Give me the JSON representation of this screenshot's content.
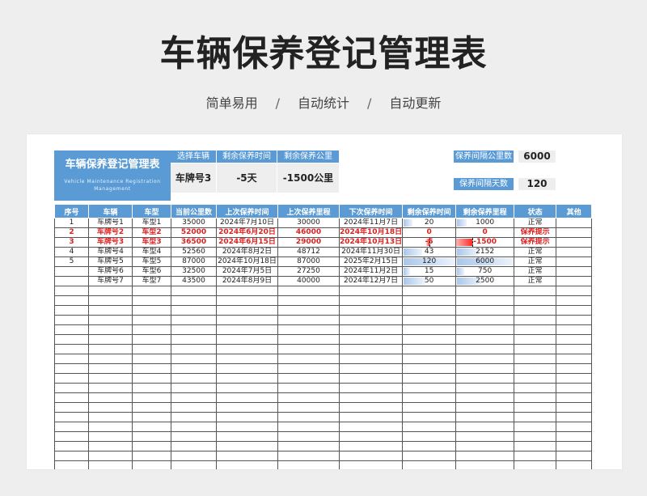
{
  "header": {
    "title": "车辆保养登记管理表",
    "tags": [
      "简单易用",
      "自动统计",
      "自动更新"
    ],
    "separator": "/"
  },
  "title_block": {
    "cn": "车辆保养登记管理表",
    "en": "Vehicle Maintenance Registration Management"
  },
  "selector": {
    "labels": [
      "选择车辆",
      "剩余保养时间",
      "剩余保养公里"
    ],
    "values": [
      "车牌号3",
      "-5天",
      "-1500公里"
    ]
  },
  "params": {
    "km_label": "保养间隔公里数",
    "km_value": "6000",
    "days_label": "保养间隔天数",
    "days_value": "120"
  },
  "table": {
    "columns": [
      "序号",
      "车辆",
      "车型",
      "当前公里数",
      "上次保养时间",
      "上次保养里程",
      "下次保养时间",
      "剩余保养时间",
      "剩余保养里程",
      "状态",
      "其他"
    ],
    "rows": [
      {
        "seq": "1",
        "car": "车牌号1",
        "model": "车型1",
        "km": "35000",
        "last_date": "2024年7月10日",
        "last_km": "30000",
        "next_date": "2024年11月7日",
        "rem_days": "20",
        "rem_km": "1000",
        "status": "正常",
        "other": "",
        "warn": false
      },
      {
        "seq": "2",
        "car": "车牌号2",
        "model": "车型2",
        "km": "52000",
        "last_date": "2024年6月20日",
        "last_km": "46000",
        "next_date": "2024年10月18日",
        "rem_days": "0",
        "rem_km": "0",
        "status": "保养提示",
        "other": "",
        "warn": true
      },
      {
        "seq": "3",
        "car": "车牌号3",
        "model": "车型3",
        "km": "36500",
        "last_date": "2024年6月15日",
        "last_km": "29000",
        "next_date": "2024年10月13日",
        "rem_days": "-5",
        "rem_km": "-1500",
        "status": "保养提示",
        "other": "",
        "warn": true
      },
      {
        "seq": "4",
        "car": "车牌号4",
        "model": "车型4",
        "km": "52560",
        "last_date": "2024年8月2日",
        "last_km": "48712",
        "next_date": "2024年11月30日",
        "rem_days": "43",
        "rem_km": "2152",
        "status": "正常",
        "other": "",
        "warn": false
      },
      {
        "seq": "5",
        "car": "车牌号5",
        "model": "车型5",
        "km": "87000",
        "last_date": "2024年10月18日",
        "last_km": "87000",
        "next_date": "2025年2月15日",
        "rem_days": "120",
        "rem_km": "6000",
        "status": "正常",
        "other": "",
        "warn": false
      },
      {
        "seq": "",
        "car": "车牌号6",
        "model": "车型6",
        "km": "32500",
        "last_date": "2024年7月5日",
        "last_km": "27250",
        "next_date": "2024年11月2日",
        "rem_days": "15",
        "rem_km": "750",
        "status": "正常",
        "other": "",
        "warn": false
      },
      {
        "seq": "",
        "car": "车牌号7",
        "model": "车型7",
        "km": "43500",
        "last_date": "2024年8月9日",
        "last_km": "40000",
        "next_date": "2024年12月7日",
        "rem_days": "50",
        "rem_km": "2500",
        "status": "正常",
        "other": "",
        "warn": false
      }
    ],
    "empty_rows": 20
  }
}
